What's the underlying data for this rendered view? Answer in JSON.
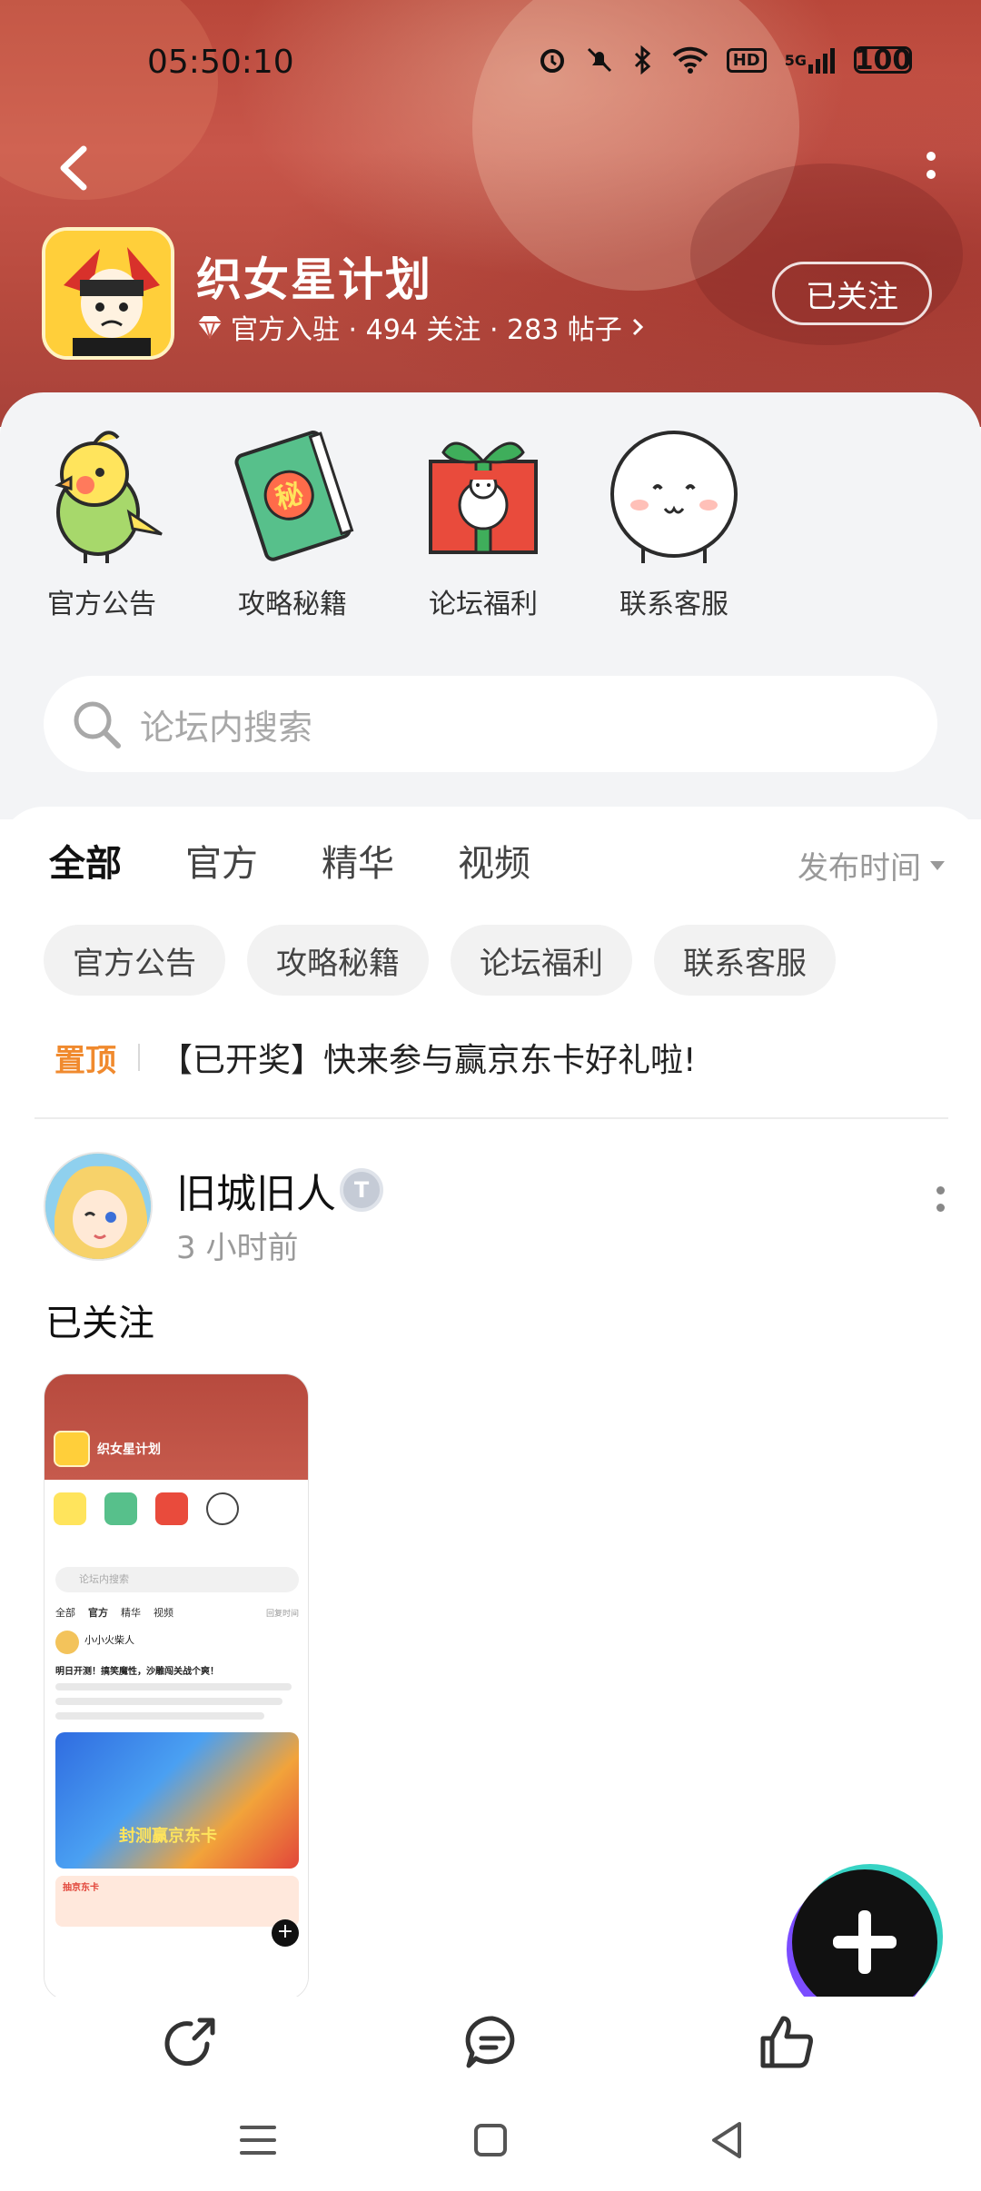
{
  "status_bar": {
    "time": "05:50:10",
    "battery": "100",
    "network": "5G",
    "hd": "HD",
    "icons": [
      "alarm-icon",
      "mute-icon",
      "bluetooth-icon",
      "wifi-icon",
      "hd-icon",
      "signal-icon",
      "battery-icon"
    ]
  },
  "header": {
    "back_icon": "chevron-left-icon",
    "more_icon": "more-vertical-icon",
    "forum_name": "织女星计划",
    "meta": "官方入驻 · 494 关注 · 283 帖子",
    "follow_label": "已关注"
  },
  "shortcuts": [
    {
      "label": "官方公告",
      "icon": "parrot-icon"
    },
    {
      "label": "攻略秘籍",
      "icon": "book-icon"
    },
    {
      "label": "论坛福利",
      "icon": "gift-icon"
    },
    {
      "label": "联系客服",
      "icon": "bun-face-icon"
    }
  ],
  "search": {
    "placeholder": "论坛内搜索",
    "icon": "search-icon"
  },
  "tabs": [
    {
      "label": "全部",
      "active": true
    },
    {
      "label": "官方",
      "active": false
    },
    {
      "label": "精华",
      "active": false
    },
    {
      "label": "视频",
      "active": false
    }
  ],
  "sort_label": "发布时间",
  "chips": [
    "官方公告",
    "攻略秘籍",
    "论坛福利",
    "联系客服"
  ],
  "pinned": {
    "tag": "置顶",
    "text": "【已开奖】快来参与赢京东卡好礼啦!"
  },
  "post": {
    "username": "旧城旧人",
    "time": "3 小时前",
    "text": "已关注",
    "image": {
      "forum_name": "织女星计划",
      "search_placeholder": "论坛内搜索",
      "tabs": [
        "全部",
        "官方",
        "精华",
        "视频"
      ],
      "sort": "回复时间",
      "poster": "小小火柴人",
      "headline": "明日开测！搞笑魔性，沙雕闯关战个爽！",
      "banner_text": "封测赢京东卡",
      "event_label": "抽京东卡"
    }
  },
  "actions": [
    {
      "name": "share",
      "icon": "share-icon"
    },
    {
      "name": "comment",
      "icon": "comment-icon"
    },
    {
      "name": "like",
      "icon": "thumbs-up-icon"
    }
  ],
  "nav": [
    "menu-icon",
    "home-square-icon",
    "back-triangle-icon"
  ],
  "colors": {
    "header_bg": "#b9473a",
    "accent": "#4fd6c6",
    "pinned_tag": "#f08a2e",
    "fab": "#111111"
  }
}
